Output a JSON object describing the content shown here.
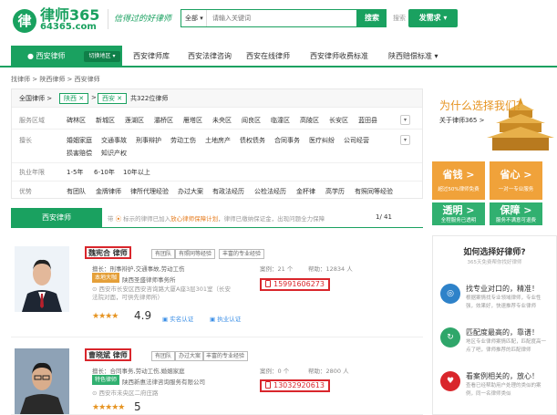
{
  "header": {
    "logo_char": "律",
    "logo_text": "律师365",
    "logo_url": "64365.com",
    "slogan": "信得过的好律师",
    "search_scope": "全部",
    "search_placeholder": "请输入关键词",
    "search_button": "搜索",
    "search_link": "搜索",
    "post_button": "发需求"
  },
  "nav": {
    "city": "西安律师",
    "switch": "切换地区",
    "items": [
      "西安律师库",
      "西安法律咨询",
      "西安在线律师",
      "西安律师收费标准",
      "陕西赔偿标准"
    ]
  },
  "breadcrumb": "找律师 > 陕西律师 > 西安律师",
  "filter": {
    "national": "全国律师",
    "tag1": "陕西",
    "tag2": "西安",
    "count": "共322位律师",
    "rows": [
      {
        "label": "服务区域",
        "items": [
          "碑林区",
          "新城区",
          "莲湖区",
          "灞桥区",
          "雁塔区",
          "未央区",
          "阎良区",
          "临潼区",
          "高陵区",
          "长安区",
          "蓝田县"
        ]
      },
      {
        "label": "擅长",
        "items": [
          "婚姻家庭",
          "交通事故",
          "刑事辩护",
          "劳动工伤",
          "土地房产",
          "债权债务",
          "合同事务",
          "医疗纠纷",
          "公司经营"
        ]
      },
      {
        "label": "",
        "items": [
          "损害赔偿",
          "知识产权"
        ]
      },
      {
        "label": "执业年限",
        "items": [
          "1-5年",
          "6-10年",
          "10年以上"
        ]
      },
      {
        "label": "优势",
        "items": [
          "有团队",
          "金牌律师",
          "律所代理经验",
          "办过大案",
          "有政法经历",
          "公检法经历",
          "金杯律",
          "高学历",
          "有照同等经验"
        ]
      }
    ]
  },
  "list_header": {
    "tab": "西安律师",
    "notice_pre": "带",
    "notice_icon": "⦿",
    "notice_mid": "标示的律师已加入",
    "notice_highlight": "放心律师保障计划",
    "notice_post": "，律师已缴纳保证金，出现问题全力保障",
    "page": "1/ 41"
  },
  "lawyers": [
    {
      "name": "魏宪合 律师",
      "tags": [
        "有团队",
        "有照同等经验",
        "丰富的专业经验"
      ],
      "expertise": "擅长：刑事辩护,交通事故,劳动工伤",
      "badge": "本地大咖",
      "firm": "陕西圣盛律师事务所",
      "address": "西安市长安区西安咨询路大厦A座3层301室（长安法院对面，可供先律师所）",
      "stars": "★★★★",
      "score": "4.9",
      "verify1": "实名认证",
      "verify2": "执业认证",
      "stat1": "案例：21 个",
      "stat2": "帮助：12834 人",
      "phone": "15991606273"
    },
    {
      "name": "曹晓斌 律师",
      "tags": [
        "有团队",
        "办过大案",
        "丰富的专业经验"
      ],
      "expertise": "擅长：合同事务,劳动工伤,婚姻家庭",
      "badge": "特色律师",
      "firm": "陕西新惠法律咨询服务有限公司",
      "address": "西安市未央区二府庄路",
      "stars": "★★★★★",
      "score": "5",
      "verify1": "",
      "verify2": "",
      "stat1": "案例：0 个",
      "stat2": "帮助：2800 人",
      "phone": "13032920613"
    }
  ],
  "sidebar": {
    "why_title": "为什么选择我们？",
    "why_link": "关于律师365 >",
    "tiles": [
      {
        "title": "省钱 >",
        "sub": "超过50%律师免费",
        "color": "#f0a23a"
      },
      {
        "title": "省心 >",
        "sub": "一对一专业服务",
        "color": "#f0a23a"
      },
      {
        "title": "透明 >",
        "sub": "全程服务已透明",
        "color": "#31b070"
      },
      {
        "title": "保障 >",
        "sub": "服务不满意可退费",
        "color": "#31b070"
      }
    ],
    "how_title": "如何选择好律师?",
    "how_sub": "365天免费帮你找好律师",
    "how_items": [
      {
        "title": "找专业对口的，精准！",
        "desc": "根据案情找专业领域律师，专业性强，效果好，快速推荐专业律师",
        "color": "#2e82c9"
      },
      {
        "title": "匹配度最高的，靠谱！",
        "desc": "地区专业律师案情匹配，匹配度高一点了吧，律师推荐的匹配律师",
        "color": "#2fa66a"
      },
      {
        "title": "看案例相关的，放心！",
        "desc": "查看已经帮助用户处理的类似的案例，同一名律师类似",
        "color": "#d9262c"
      }
    ]
  }
}
